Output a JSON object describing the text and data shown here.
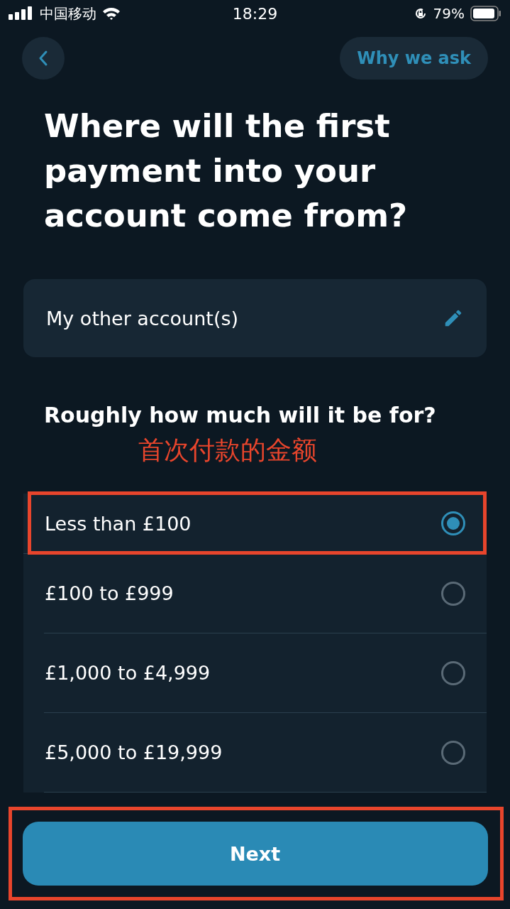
{
  "status_bar": {
    "carrier": "中国移动",
    "time": "18:29",
    "battery": "79%"
  },
  "nav": {
    "why_button": "Why we ask"
  },
  "title": "Where will the first payment into your account come from?",
  "source": {
    "value": "My other account(s)"
  },
  "question": "Roughly how much will it be for?",
  "annotation": "首次付款的金额",
  "options": [
    {
      "label": "Less than £100",
      "selected": true
    },
    {
      "label": "£100 to £999",
      "selected": false
    },
    {
      "label": "£1,000 to £4,999",
      "selected": false
    },
    {
      "label": "£5,000 to £19,999",
      "selected": false
    }
  ],
  "next_button": "Next"
}
